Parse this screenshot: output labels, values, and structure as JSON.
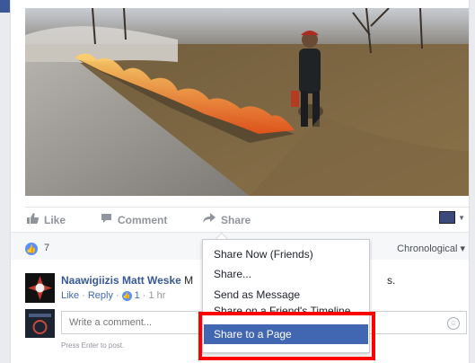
{
  "post": {
    "photo_alt": "",
    "actions": {
      "like": "Like",
      "comment": "Comment",
      "share": "Share"
    }
  },
  "reactions": {
    "count": "7",
    "order_label": "Chronological ▾"
  },
  "comment": {
    "author": "Naawigiizis Matt Weske",
    "author_trail": "M",
    "trail_end": "s.",
    "like_label": "Like",
    "sep1": "·",
    "reply_label": "Reply",
    "sep2": "·",
    "like_count": "1",
    "sep3": "·",
    "time": "1 hr"
  },
  "composer": {
    "placeholder": "Write a comment...",
    "hint": "Press Enter to post."
  },
  "share_menu": {
    "items": [
      "Share Now (Friends)",
      "Share...",
      "Send as Message",
      "Share on a Friend's Timeline",
      "Share to a Page"
    ],
    "selected_index": 4
  },
  "colors": {
    "brand": "#3b5998",
    "link": "#4267b2",
    "selected_item": "#4267b2",
    "highlight_box": "#ff0000",
    "like_bubble": "#5890ff"
  },
  "icons": {
    "like": "thumbs-up-icon",
    "comment": "comment-bubble-icon",
    "share": "share-arrow-icon",
    "emoji": "smiley-icon"
  }
}
